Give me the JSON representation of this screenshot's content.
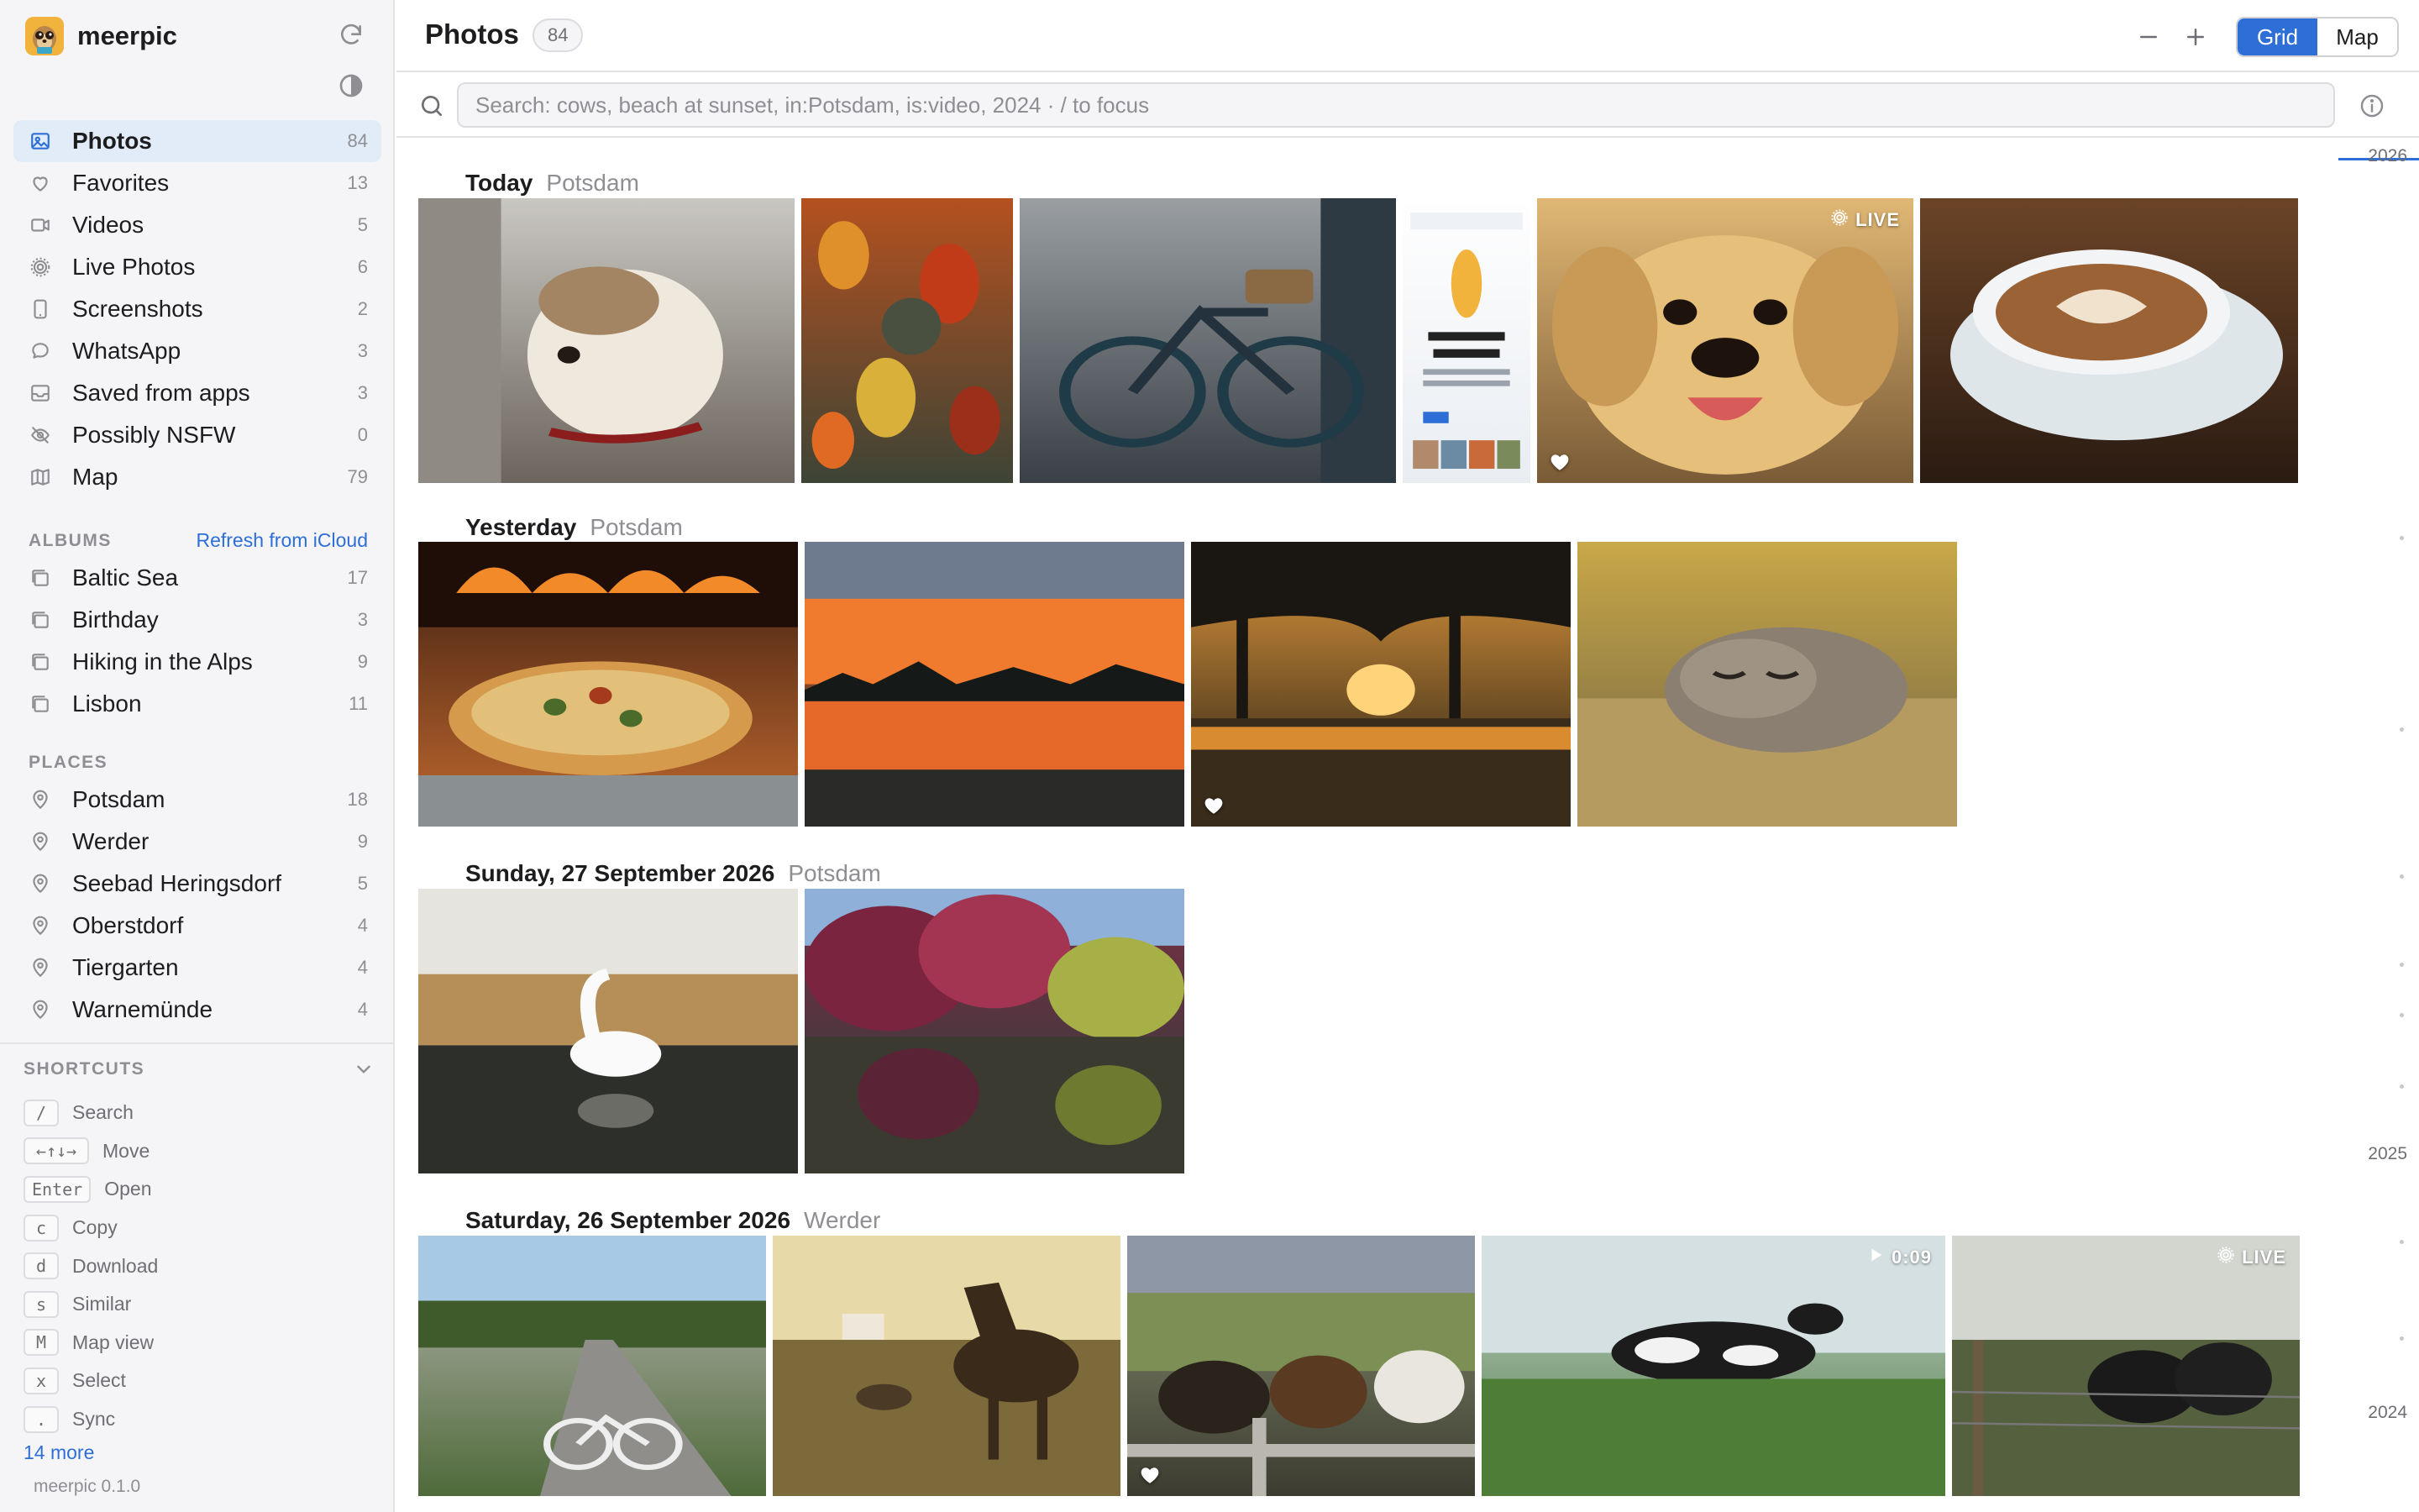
{
  "app": {
    "name": "meerpic",
    "version": "meerpic 0.1.0"
  },
  "sidebar": {
    "library": [
      {
        "label": "Photos",
        "count": "84",
        "icon": "photo-icon",
        "active": true
      },
      {
        "label": "Favorites",
        "count": "13",
        "icon": "heart-icon"
      },
      {
        "label": "Videos",
        "count": "5",
        "icon": "video-icon"
      },
      {
        "label": "Live Photos",
        "count": "6",
        "icon": "live-icon"
      },
      {
        "label": "Screenshots",
        "count": "2",
        "icon": "phone-icon"
      },
      {
        "label": "WhatsApp",
        "count": "3",
        "icon": "chat-icon"
      },
      {
        "label": "Saved from apps",
        "count": "3",
        "icon": "tray-icon"
      },
      {
        "label": "Possibly NSFW",
        "count": "0",
        "icon": "eye-off-icon"
      },
      {
        "label": "Map",
        "count": "79",
        "icon": "map-icon"
      }
    ],
    "albums_heading": "ALBUMS",
    "albums_action": "Refresh from iCloud",
    "albums": [
      {
        "label": "Baltic Sea",
        "count": "17"
      },
      {
        "label": "Birthday",
        "count": "3"
      },
      {
        "label": "Hiking in the Alps",
        "count": "9"
      },
      {
        "label": "Lisbon",
        "count": "11"
      }
    ],
    "places_heading": "PLACES",
    "places": [
      {
        "label": "Potsdam",
        "count": "18"
      },
      {
        "label": "Werder",
        "count": "9"
      },
      {
        "label": "Seebad Heringsdorf",
        "count": "5"
      },
      {
        "label": "Oberstdorf",
        "count": "4"
      },
      {
        "label": "Tiergarten",
        "count": "4"
      },
      {
        "label": "Warnemünde",
        "count": "4"
      }
    ],
    "shortcuts_heading": "SHORTCUTS",
    "shortcuts": [
      {
        "key": "/",
        "label": "Search"
      },
      {
        "key": "←↑↓→",
        "label": "Move"
      },
      {
        "key": "Enter",
        "label": "Open"
      },
      {
        "key": "c",
        "label": "Copy"
      },
      {
        "key": "d",
        "label": "Download"
      },
      {
        "key": "s",
        "label": "Similar"
      },
      {
        "key": "M",
        "label": "Map view"
      },
      {
        "key": "x",
        "label": "Select"
      },
      {
        "key": ".",
        "label": "Sync"
      }
    ],
    "more_shortcuts": "14 more"
  },
  "header": {
    "title": "Photos",
    "count": "84",
    "view_grid": "Grid",
    "view_map": "Map",
    "active_view": "Grid"
  },
  "search": {
    "placeholder": "Search: cows, beach at sunset, in:Potsdam, is:video, 2024 · / to focus",
    "value": ""
  },
  "days": [
    {
      "date": "Today",
      "place": "Potsdam",
      "photos": [
        {
          "subject": "dog-window",
          "colors": [
            "#c9c7c2",
            "#6b655d"
          ]
        },
        {
          "subject": "autumn-leaves",
          "colors": [
            "#b4511f",
            "#3d4436"
          ]
        },
        {
          "subject": "bicycle",
          "colors": [
            "#9a9ea1",
            "#394046"
          ]
        },
        {
          "subject": "screenshot",
          "colors": [
            "#ffffff",
            "#e9edf2"
          ]
        },
        {
          "subject": "puppy",
          "colors": [
            "#e0b774",
            "#7a5b36"
          ],
          "live": true,
          "favorite": true
        },
        {
          "subject": "coffee",
          "colors": [
            "#6b4427",
            "#2a1b12"
          ]
        }
      ]
    },
    {
      "date": "Yesterday",
      "place": "Potsdam",
      "photos": [
        {
          "subject": "pizza",
          "colors": [
            "#3a1d10",
            "#c1692f"
          ]
        },
        {
          "subject": "sunset-lake",
          "colors": [
            "#ee6b2c",
            "#1d2327"
          ]
        },
        {
          "subject": "sunset-trees",
          "colors": [
            "#e49a3c",
            "#1c1a14"
          ],
          "favorite": true
        },
        {
          "subject": "sleeping-cat",
          "colors": [
            "#c9a848",
            "#6f6242"
          ]
        }
      ]
    },
    {
      "date": "Sunday, 27 September 2026",
      "place": "Potsdam",
      "photos": [
        {
          "subject": "swan",
          "colors": [
            "#d6d3cc",
            "#4b4a3e"
          ]
        },
        {
          "subject": "autumn-lake",
          "colors": [
            "#7a2f46",
            "#283c38"
          ]
        }
      ]
    },
    {
      "date": "Saturday, 26 September 2026",
      "place": "Werder",
      "photos": [
        {
          "subject": "bike-path",
          "colors": [
            "#b9b8b3",
            "#4f6a3a"
          ]
        },
        {
          "subject": "horses",
          "colors": [
            "#d9c48a",
            "#4a3a24"
          ]
        },
        {
          "subject": "cows-fence",
          "colors": [
            "#8a9474",
            "#3c3b30"
          ],
          "favorite": true
        },
        {
          "subject": "cow-meadow",
          "colors": [
            "#c8d6d8",
            "#4c7a3a"
          ],
          "video": "0:09"
        },
        {
          "subject": "black-cows",
          "colors": [
            "#c7ccc4",
            "#39422e"
          ],
          "live": true
        }
      ]
    }
  ],
  "live_label": "LIVE",
  "timeline": {
    "years": [
      "2026",
      "2025",
      "2024"
    ]
  },
  "colors": {
    "accent": "#2d6fd6",
    "sidebar_bg": "#f5f5f7",
    "active_bg": "#e2ecf9"
  }
}
